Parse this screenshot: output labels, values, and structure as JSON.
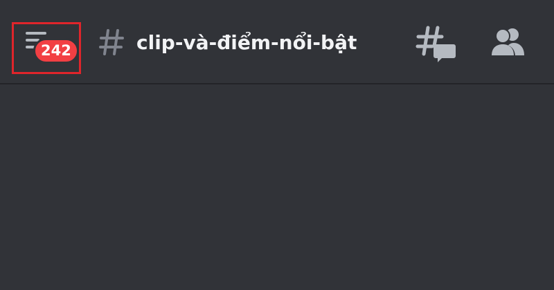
{
  "header": {
    "unread_count": "242",
    "channel_name": "clip-và-điểm-nổi-bật"
  },
  "icons": {
    "menu": "hamburger-menu-icon",
    "channel": "hash-icon",
    "threads": "threads-icon",
    "members": "members-icon"
  },
  "colors": {
    "background": "#313338",
    "badge": "#f23f43",
    "highlight_box": "#e0252b",
    "icon": "#b5bac1",
    "text": "#f2f3f5"
  }
}
